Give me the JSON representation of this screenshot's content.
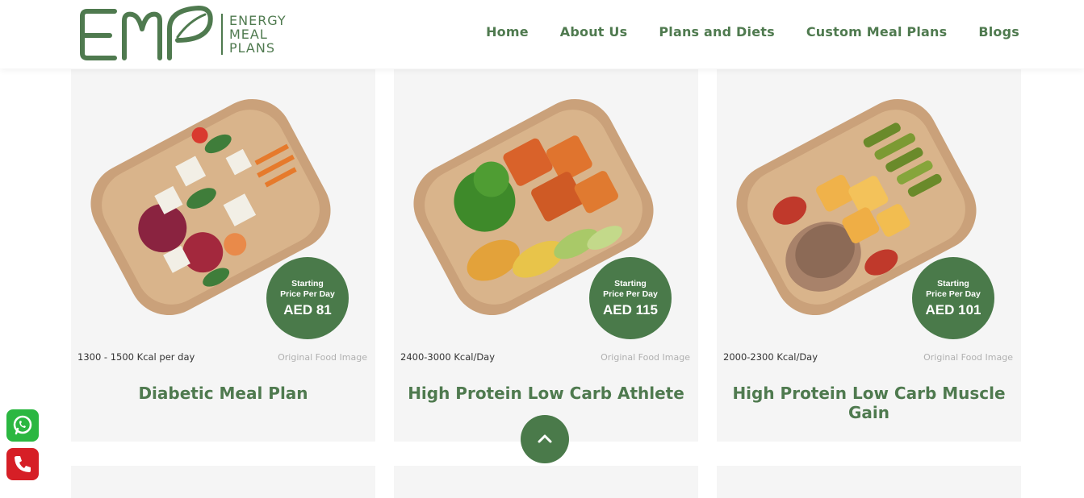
{
  "header": {
    "logo": {
      "mark": "EMP",
      "line1": "ENERGY",
      "line2": "MEAL",
      "line3": "PLANS"
    },
    "nav": [
      "Home",
      "About Us",
      "Plans and Diets",
      "Custom Meal Plans",
      "Blogs"
    ]
  },
  "cards": [
    {
      "title": "Diabetic Meal Plan",
      "kcal": "1300 - 1500 Kcal per day",
      "image_label": "Original Food Image",
      "badge_line1": "Starting",
      "badge_line2": "Price Per Day",
      "price": "AED 81"
    },
    {
      "title": "High Protein Low Carb Athlete",
      "kcal": "2400-3000 Kcal/Day",
      "image_label": "Original Food Image",
      "badge_line1": "Starting",
      "badge_line2": "Price Per Day",
      "price": "AED 115"
    },
    {
      "title": "High Protein Low Carb Muscle Gain",
      "kcal": "2000-2300 Kcal/Day",
      "image_label": "Original Food Image",
      "badge_line1": "Starting",
      "badge_line2": "Price Per Day",
      "price": "AED 101"
    }
  ],
  "colors": {
    "brand_green": "#4a7a4a",
    "card_bg": "#f5f5f5",
    "whatsapp": "#2bb741",
    "phone": "#d61f26"
  },
  "icons": {
    "scroll_top": "chevron-up-icon",
    "whatsapp": "whatsapp-icon",
    "phone": "phone-icon"
  }
}
